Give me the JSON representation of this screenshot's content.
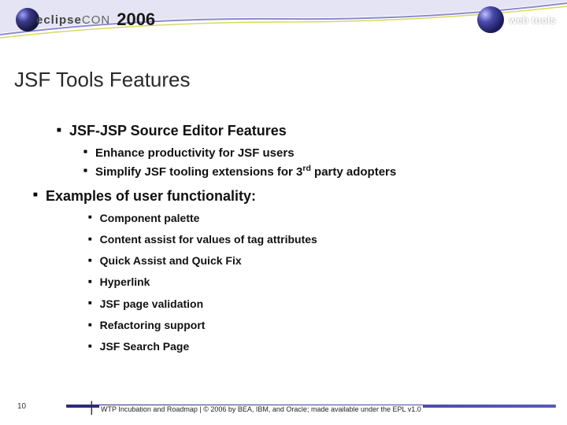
{
  "header": {
    "conference_brand_left": "eclipse",
    "conference_brand_right": "CON",
    "year": "2006",
    "right_logo_text": "web tools"
  },
  "title": "JSF Tools Features",
  "bullets": {
    "l1a": "JSF-JSP Source Editor Features",
    "l2a": "Enhance productivity for JSF users",
    "l2b_pre": "Simplify JSF tooling extensions for 3",
    "l2b_sup": "rd",
    "l2b_post": " party adopters",
    "l1b": "Examples of user functionality:",
    "l3": [
      "Component palette",
      "Content assist for values of tag attributes",
      "Quick Assist and Quick Fix",
      "Hyperlink",
      "JSF page validation",
      "Refactoring support",
      "JSF Search Page"
    ]
  },
  "footer": {
    "page": "10",
    "text": "WTP Incubation and Roadmap  |  © 2006 by BEA, IBM, and Oracle; made available under the EPL v1.0"
  }
}
